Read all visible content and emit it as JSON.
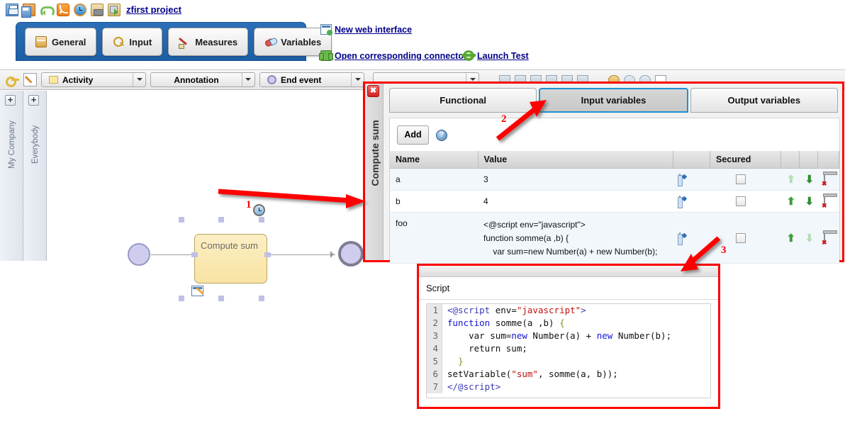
{
  "topbar": {
    "icons": [
      "save-icon",
      "save-all-icon",
      "undo-icon",
      "rss-icon",
      "alarm-clock-icon",
      "package-icon",
      "package-deploy-icon"
    ],
    "project_link": "zfirst project"
  },
  "main_tabs": [
    {
      "label": "General",
      "icon": "folder-icon"
    },
    {
      "label": "Input",
      "icon": "magnifier-icon"
    },
    {
      "label": "Measures",
      "icon": "pen-icon"
    },
    {
      "label": "Variables",
      "icon": "capsule-icon"
    }
  ],
  "links": {
    "web_interface": "New web interface",
    "open_connector": "Open corresponding connector",
    "launch_test": "Launch Test"
  },
  "toolbar2": {
    "key_icon": "key-icon",
    "edit_icon": "pencil-icon",
    "dropdowns": [
      {
        "label": "Activity",
        "swatch": "activity-swatch"
      },
      {
        "label": "Annotation",
        "swatch": "none"
      },
      {
        "label": "End event",
        "swatch": "end-event-circle"
      }
    ]
  },
  "canvas": {
    "rails": [
      {
        "label": "My Company",
        "plus": "+"
      },
      {
        "label": "Everybody",
        "plus": "+"
      }
    ],
    "nodes": {
      "start": "start-event",
      "task": "Compute sum",
      "end": "end-event"
    }
  },
  "panel": {
    "vertical_title": "Compute sum",
    "close": "✖",
    "tabs": [
      {
        "label": "Functional",
        "active": false
      },
      {
        "label": "Input variables",
        "active": true
      },
      {
        "label": "Output variables",
        "active": false
      }
    ],
    "add_button": "Add",
    "help_icon": "?",
    "table": {
      "headers": [
        "Name",
        "Value",
        "",
        "Secured",
        "",
        "",
        ""
      ],
      "rows": [
        {
          "name": "a",
          "value": "3",
          "secured": false,
          "up_enabled": false,
          "down_enabled": true
        },
        {
          "name": "b",
          "value": "4",
          "secured": false,
          "up_enabled": true,
          "down_enabled": true
        },
        {
          "name": "foo",
          "value": "<@script env=\"javascript\">\nfunction somme(a ,b) {\n    var sum=new Number(a) + new Number(b);",
          "secured": false,
          "up_enabled": true,
          "down_enabled": false
        }
      ]
    }
  },
  "script_dialog": {
    "label": "Script",
    "lines": [
      {
        "no": "1",
        "text": "<@script env=\"javascript\">"
      },
      {
        "no": "2",
        "text": "function somme(a ,b) {"
      },
      {
        "no": "3",
        "text": "    var sum=new Number(a) + new Number(b);"
      },
      {
        "no": "4",
        "text": "    return sum;"
      },
      {
        "no": "5",
        "text": "  }"
      },
      {
        "no": "6",
        "text": "setVariable(\"sum\", somme(a, b));"
      },
      {
        "no": "7",
        "text": "</@script>"
      }
    ]
  },
  "annotations": [
    {
      "number": "1"
    },
    {
      "number": "2"
    },
    {
      "number": "3"
    }
  ],
  "colors": {
    "accent_blue": "#1e90d2",
    "panel_blue": "#2b6fb8",
    "annotation_red": "#ff0000",
    "link_blue": "#00008b",
    "task_yellow": "#f8e3a3"
  }
}
